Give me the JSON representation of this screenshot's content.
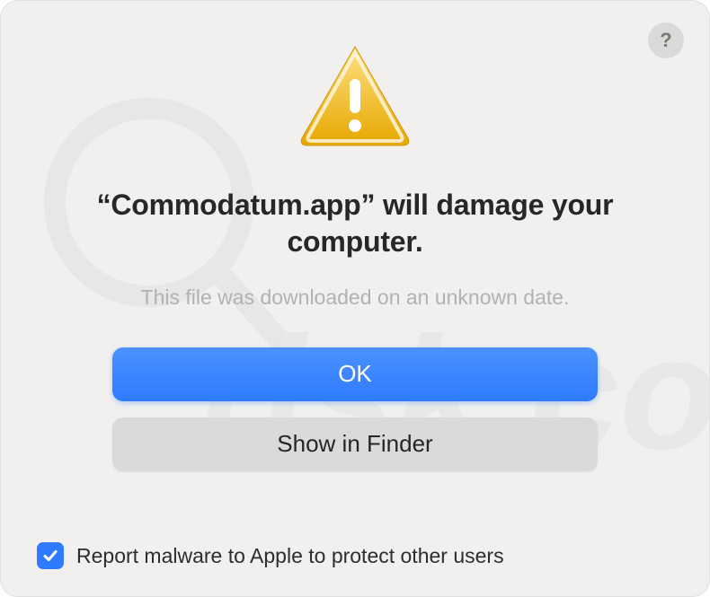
{
  "dialog": {
    "help_tooltip": "?",
    "headline": "“Commodatum.app” will damage your computer.",
    "subtext": "This file was downloaded on an unknown date.",
    "primary_button_label": "OK",
    "secondary_button_label": "Show in Finder",
    "checkbox_label": "Report malware to Apple to protect other users",
    "checkbox_checked": true
  },
  "icons": {
    "warning": "warning-triangle",
    "help": "question-mark",
    "checkmark": "checkmark"
  },
  "colors": {
    "accent": "#2f7bff",
    "warning_fill": "#f4b400",
    "dialog_bg": "#f1f0ef",
    "secondary_btn_bg": "#dcdad8",
    "subtext": "#b3b2b0"
  }
}
